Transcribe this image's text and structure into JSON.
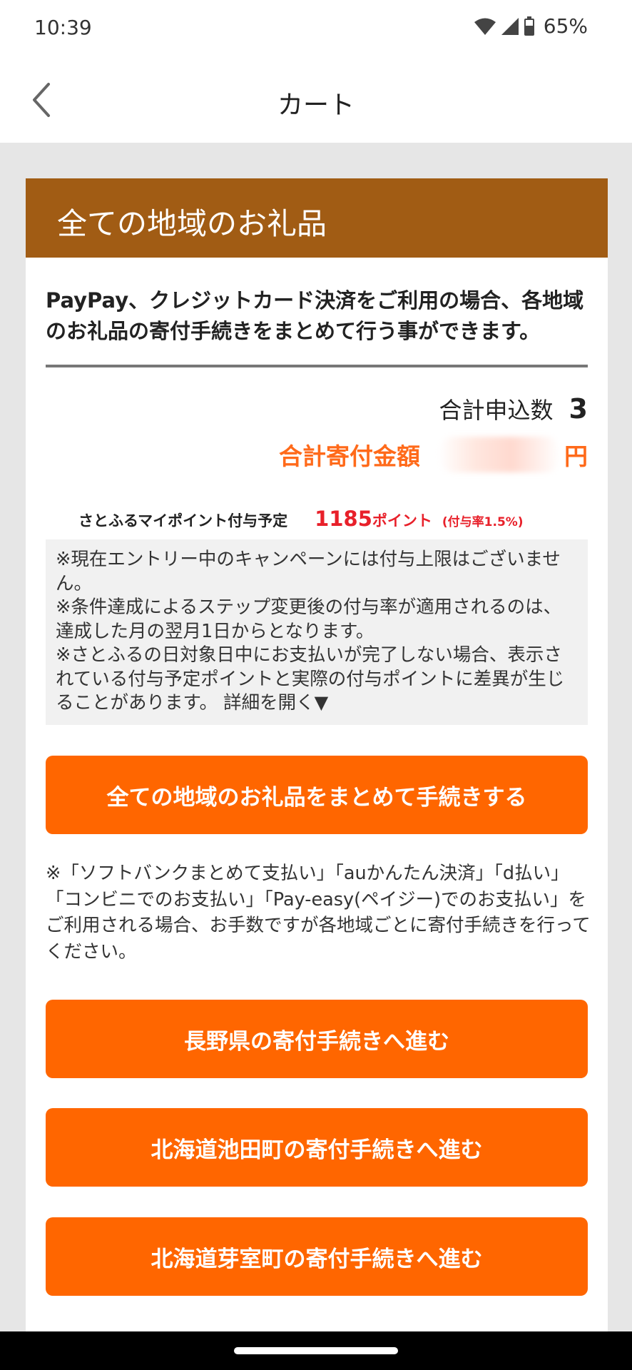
{
  "status_bar": {
    "time": "10:39",
    "battery": "65%",
    "icons": [
      "wifi-icon",
      "signal-icon",
      "battery-icon"
    ]
  },
  "app_bar": {
    "title": "カート",
    "back_icon": "chevron-left-icon"
  },
  "section": {
    "header": "全ての地域のお礼品",
    "intro": "PayPay、クレジットカード決済をご利用の場合、各地域のお礼品の寄付手続きをまとめて行う事ができます。",
    "total_count_label": "合計申込数",
    "total_count": "3",
    "total_amount_label": "合計寄付金額",
    "total_amount_unit": "円",
    "points_label": "さとふるマイポイント付与予定",
    "points_value": "1185",
    "points_unit": "ポイント",
    "points_rate": "(付与率1.5%)",
    "notes": {
      "line1": "※現在エントリー中のキャンペーンには付与上限はございません。",
      "line2": "※条件達成によるステップ変更後の付与率が適用されるのは、達成した月の翌月1日からとなります。",
      "line3": "※さとふるの日対象日中にお支払いが完了しない場合、表示されている付与予定ポイントと実際の付与ポイントに差異が生じることがあります。",
      "details_link": "詳細を開く▼"
    },
    "all_button": "全ての地域のお礼品をまとめて手続きする",
    "payment_note": "※「ソフトバンクまとめて支払い」「auかんたん決済」「d払い」「コンビニでのお支払い」「Pay-easy(ペイジー)でのお支払い」をご利用される場合、お手数ですが各地域ごとに寄付手続きを行ってください。",
    "region_buttons": {
      "nagano": "長野県の寄付手続きへ進む",
      "ikeda": "北海道池田町の寄付手続きへ進む",
      "memuro": "北海道芽室町の寄付手続きへ進む"
    }
  },
  "colors": {
    "header_brown": "#a15c14",
    "accent_orange": "#ff6600",
    "amount_orange": "#ff6a1a",
    "points_red": "#e8202a"
  }
}
